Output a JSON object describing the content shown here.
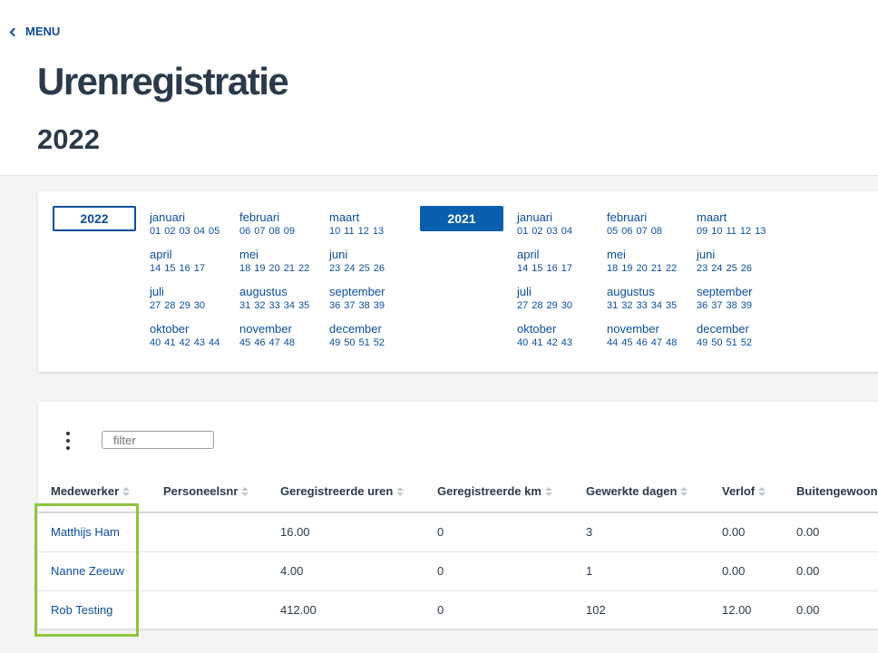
{
  "header": {
    "menu_label": "MENU",
    "title": "Urenregistratie",
    "year": "2022"
  },
  "calendar": {
    "years": [
      {
        "label": "2022",
        "active": false,
        "months": [
          {
            "name": "januari",
            "weeks": [
              "01",
              "02",
              "03",
              "04",
              "05"
            ]
          },
          {
            "name": "februari",
            "weeks": [
              "06",
              "07",
              "08",
              "09"
            ]
          },
          {
            "name": "maart",
            "weeks": [
              "10",
              "11",
              "12",
              "13"
            ]
          },
          {
            "name": "april",
            "weeks": [
              "14",
              "15",
              "16",
              "17"
            ]
          },
          {
            "name": "mei",
            "weeks": [
              "18",
              "19",
              "20",
              "21",
              "22"
            ]
          },
          {
            "name": "juni",
            "weeks": [
              "23",
              "24",
              "25",
              "26"
            ]
          },
          {
            "name": "juli",
            "weeks": [
              "27",
              "28",
              "29",
              "30"
            ]
          },
          {
            "name": "augustus",
            "weeks": [
              "31",
              "32",
              "33",
              "34",
              "35"
            ]
          },
          {
            "name": "september",
            "weeks": [
              "36",
              "37",
              "38",
              "39"
            ]
          },
          {
            "name": "oktober",
            "weeks": [
              "40",
              "41",
              "42",
              "43",
              "44"
            ]
          },
          {
            "name": "november",
            "weeks": [
              "45",
              "46",
              "47",
              "48"
            ]
          },
          {
            "name": "december",
            "weeks": [
              "49",
              "50",
              "51",
              "52"
            ]
          }
        ]
      },
      {
        "label": "2021",
        "active": true,
        "months": [
          {
            "name": "januari",
            "weeks": [
              "01",
              "02",
              "03",
              "04"
            ]
          },
          {
            "name": "februari",
            "weeks": [
              "05",
              "06",
              "07",
              "08"
            ]
          },
          {
            "name": "maart",
            "weeks": [
              "09",
              "10",
              "11",
              "12",
              "13"
            ]
          },
          {
            "name": "april",
            "weeks": [
              "14",
              "15",
              "16",
              "17"
            ]
          },
          {
            "name": "mei",
            "weeks": [
              "18",
              "19",
              "20",
              "21",
              "22"
            ]
          },
          {
            "name": "juni",
            "weeks": [
              "23",
              "24",
              "25",
              "26"
            ]
          },
          {
            "name": "juli",
            "weeks": [
              "27",
              "28",
              "29",
              "30"
            ]
          },
          {
            "name": "augustus",
            "weeks": [
              "31",
              "32",
              "33",
              "34",
              "35"
            ]
          },
          {
            "name": "september",
            "weeks": [
              "36",
              "37",
              "38",
              "39"
            ]
          },
          {
            "name": "oktober",
            "weeks": [
              "40",
              "41",
              "42",
              "43"
            ]
          },
          {
            "name": "november",
            "weeks": [
              "44",
              "45",
              "46",
              "47",
              "48"
            ]
          },
          {
            "name": "december",
            "weeks": [
              "49",
              "50",
              "51",
              "52"
            ]
          }
        ]
      }
    ]
  },
  "table": {
    "filter_placeholder": "filter",
    "columns": [
      {
        "label": "Medewerker",
        "sortable": true
      },
      {
        "label": "Personeelsnr",
        "sortable": true
      },
      {
        "label": "Geregistreerde uren",
        "sortable": true
      },
      {
        "label": "Geregistreerde km",
        "sortable": true
      },
      {
        "label": "Gewerkte dagen",
        "sortable": true
      },
      {
        "label": "Verlof",
        "sortable": true
      },
      {
        "label": "Buitengewoon",
        "sortable": true
      }
    ],
    "rows": [
      [
        "Matthijs Ham",
        "",
        "16.00",
        "0",
        "3",
        "0.00",
        "0.00"
      ],
      [
        "Nanne Zeeuw",
        "",
        "4.00",
        "0",
        "1",
        "0.00",
        "0.00"
      ],
      [
        "Rob Testing",
        "",
        "412.00",
        "0",
        "102",
        "12.00",
        "0.00"
      ]
    ]
  },
  "colors": {
    "accent": "#0a4f9c",
    "active_year_bg": "#0a5eae",
    "highlight": "#8dc63f",
    "title": "#2b3a4a"
  }
}
